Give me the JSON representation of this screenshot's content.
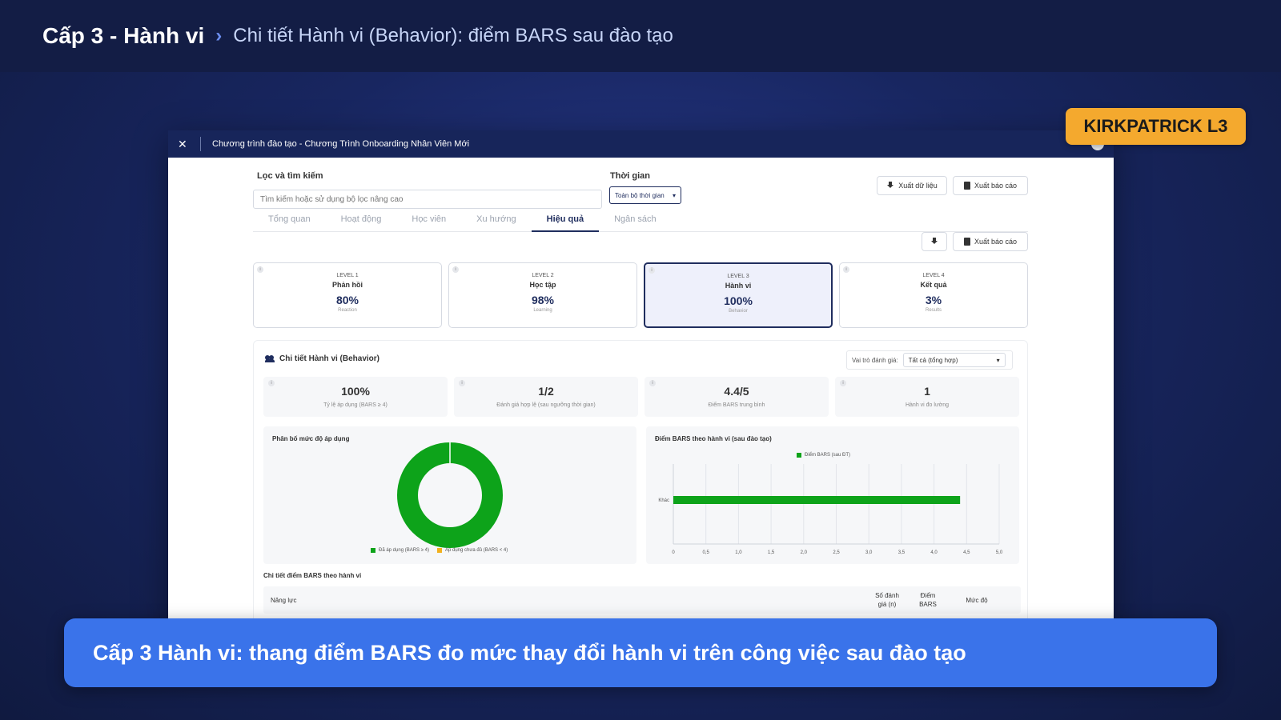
{
  "header": {
    "breadcrumb_main": "Cấp 3 - Hành vi",
    "separator": "›",
    "breadcrumb_sub": "Chi tiết Hành vi (Behavior): điểm BARS sau đào tạo"
  },
  "badge": "KIRKPATRICK L3",
  "window": {
    "title": "Chương trình đào tạo - Chương Trình Onboarding Nhân Viên Mới",
    "close": "✕",
    "filter_label": "Lọc và tìm kiếm",
    "search_placeholder": "Tìm kiếm hoặc sử dụng bộ lọc nâng cao",
    "time_label": "Thời gian",
    "time_value": "Toàn bộ thời gian",
    "export_data": "Xuất dữ liệu",
    "export_report": "Xuất báo cáo",
    "export_report_2": "Xuất báo cáo",
    "tabs": [
      {
        "label": "Tổng quan"
      },
      {
        "label": "Hoạt động"
      },
      {
        "label": "Học viên"
      },
      {
        "label": "Xu hướng"
      },
      {
        "label": "Hiệu quả"
      },
      {
        "label": "Ngân sách"
      }
    ],
    "active_tab": "Hiệu quả",
    "levels": [
      {
        "level": "LEVEL 1",
        "name": "Phản hồi",
        "value": "80%",
        "sub": "Reaction"
      },
      {
        "level": "LEVEL 2",
        "name": "Học tập",
        "value": "98%",
        "sub": "Learning"
      },
      {
        "level": "LEVEL 3",
        "name": "Hành vi",
        "value": "100%",
        "sub": "Behavior"
      },
      {
        "level": "LEVEL 4",
        "name": "Kết quả",
        "value": "3%",
        "sub": "Results"
      }
    ],
    "detail": {
      "title": "Chi tiết Hành vi (Behavior)",
      "role_label": "Vai trò đánh giá:",
      "role_value": "Tất cả (tổng hợp)",
      "stats": [
        {
          "value": "100%",
          "label": "Tỷ lệ áp dụng (BARS ≥ 4)"
        },
        {
          "value": "1/2",
          "label": "Đánh giá hợp lệ (sau ngưỡng thời gian)"
        },
        {
          "value": "4.4/5",
          "label": "Điểm BARS trung bình"
        },
        {
          "value": "1",
          "label": "Hành vi đo lường"
        }
      ],
      "donut_title": "Phân bố mức độ áp dụng",
      "bar_title": "Điểm BARS theo hành vi (sau đào tạo)",
      "table_title": "Chi tiết điểm BARS theo hành vi",
      "columns": {
        "c1": "Năng lực",
        "c2a": "Số đánh",
        "c2b": "giá (n)",
        "c3a": "Điểm",
        "c3b": "BARS",
        "c4": "Mức độ"
      }
    }
  },
  "chart_data": [
    {
      "type": "pie",
      "title": "Phân bố mức độ áp dụng",
      "categories": [
        "Đã áp dụng (BARS ≥ 4)",
        "Áp dụng chưa đủ (BARS < 4)"
      ],
      "values": [
        100,
        0
      ],
      "colors": [
        "#0da31a",
        "#f2b01e"
      ],
      "legend": "bottom"
    },
    {
      "type": "bar",
      "orientation": "horizontal",
      "title": "Điểm BARS theo hành vi (sau đào tạo)",
      "categories": [
        "Khác"
      ],
      "series": [
        {
          "name": "Điểm BARS (sau ĐT)",
          "values": [
            4.4
          ],
          "color": "#0da31a"
        }
      ],
      "xlim": [
        0,
        5
      ],
      "xticks": [
        "0",
        "0,5",
        "1,0",
        "1,5",
        "2,0",
        "2,5",
        "3,0",
        "3,5",
        "4,0",
        "4,5",
        "5,0"
      ],
      "grid": true,
      "legend": "top"
    }
  ],
  "caption": "Cấp 3 Hành vi: thang điểm BARS đo mức thay đổi hành vi trên công việc sau đào tạo"
}
